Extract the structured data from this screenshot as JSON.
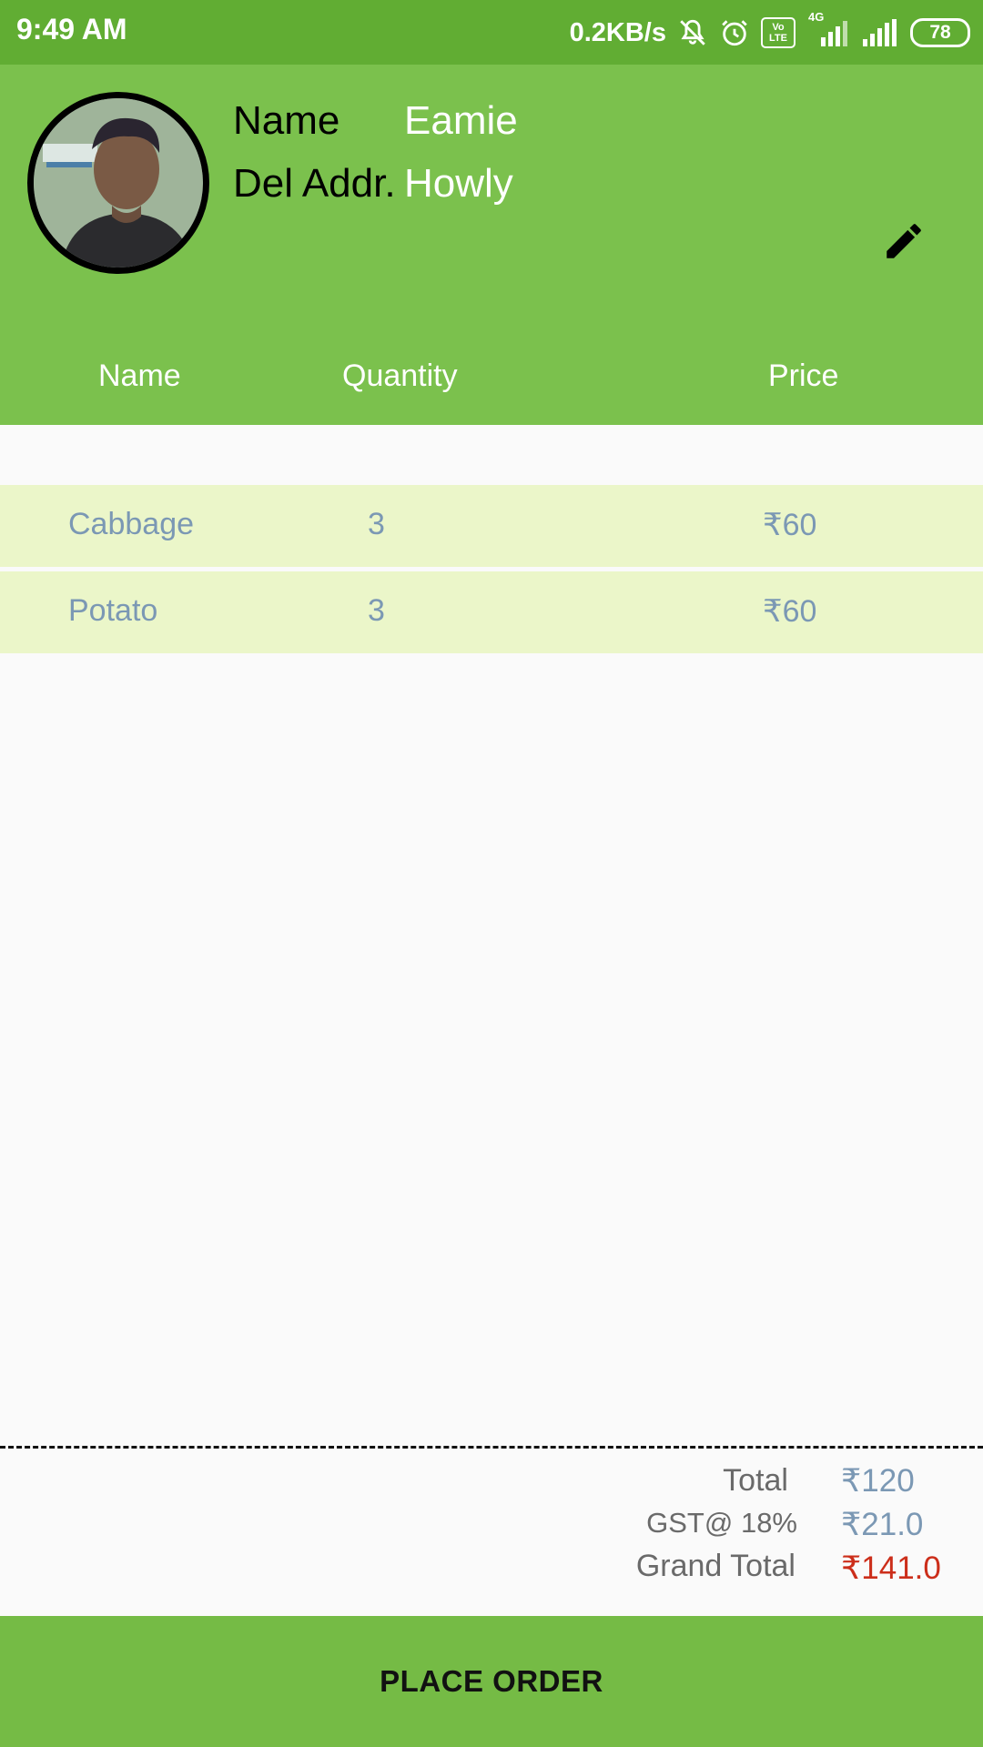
{
  "status_bar": {
    "time": "9:49 AM",
    "network_speed": "0.2KB/s",
    "volte_top": "Vo",
    "volte_bottom": "LTE",
    "network_type": "4G",
    "battery": "78",
    "icons": [
      "mute-bell-icon",
      "alarm-icon",
      "volte-icon",
      "signal-icon",
      "signal-icon",
      "battery-icon"
    ]
  },
  "profile": {
    "name_label": "Name",
    "name_value": "Eamie",
    "address_label": "Del Addr.",
    "address_value": "Howly",
    "edit_icon": "pencil-icon"
  },
  "table": {
    "columns": [
      "Name",
      "Quantity",
      "Price"
    ],
    "rows": [
      {
        "name": "Cabbage",
        "quantity": "3",
        "price": "₹60"
      },
      {
        "name": "Potato",
        "quantity": "3",
        "price": "₹60"
      }
    ]
  },
  "summary": {
    "total_label": "Total",
    "total_value": "₹120",
    "gst_label": "GST@ 18%",
    "gst_value": "₹21.0",
    "grand_label": "Grand Total",
    "grand_value": "₹141.0",
    "grand_color": "#cc2e1a"
  },
  "action": {
    "place_order": "PLACE ORDER"
  },
  "colors": {
    "status_bar": "#61ad33",
    "header": "#7bc14d",
    "row_background": "#ebf6c9",
    "button": "#75bb45"
  }
}
